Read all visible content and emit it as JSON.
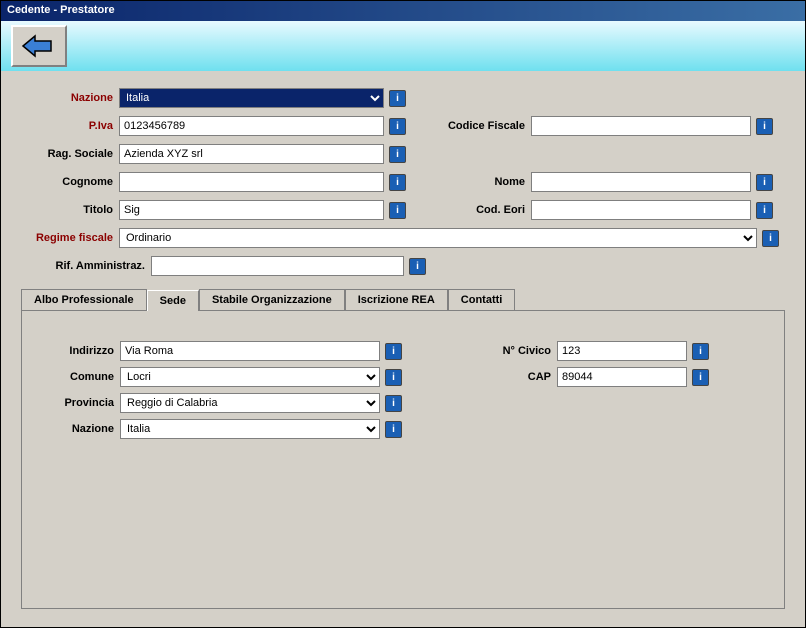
{
  "title": "Cedente - Prestatore",
  "fields": {
    "nazione": {
      "label": "Nazione",
      "value": "Italia"
    },
    "piva": {
      "label": "P.Iva",
      "value": "0123456789"
    },
    "codfisc": {
      "label": "Codice Fiscale",
      "value": ""
    },
    "ragsoc": {
      "label": "Rag. Sociale",
      "value": "Azienda XYZ srl"
    },
    "cognome": {
      "label": "Cognome",
      "value": ""
    },
    "nome": {
      "label": "Nome",
      "value": ""
    },
    "titolo": {
      "label": "Titolo",
      "value": "Sig"
    },
    "codeori": {
      "label": "Cod. Eori",
      "value": ""
    },
    "regime": {
      "label": "Regime fiscale",
      "value": "Ordinario"
    },
    "rifamm": {
      "label": "Rif. Amministraz.",
      "value": ""
    }
  },
  "tabs": {
    "albo": "Albo Professionale",
    "sede": "Sede",
    "stabile": "Stabile Organizzazione",
    "rea": "Iscrizione REA",
    "contatti": "Contatti"
  },
  "sede": {
    "indirizzo": {
      "label": "Indirizzo",
      "value": "Via Roma"
    },
    "comune": {
      "label": "Comune",
      "value": "Locri"
    },
    "provincia": {
      "label": "Provincia",
      "value": "Reggio di Calabria"
    },
    "nazione": {
      "label": "Nazione",
      "value": "Italia"
    },
    "ncivico": {
      "label": "N° Civico",
      "value": "123"
    },
    "cap": {
      "label": "CAP",
      "value": "89044"
    }
  }
}
